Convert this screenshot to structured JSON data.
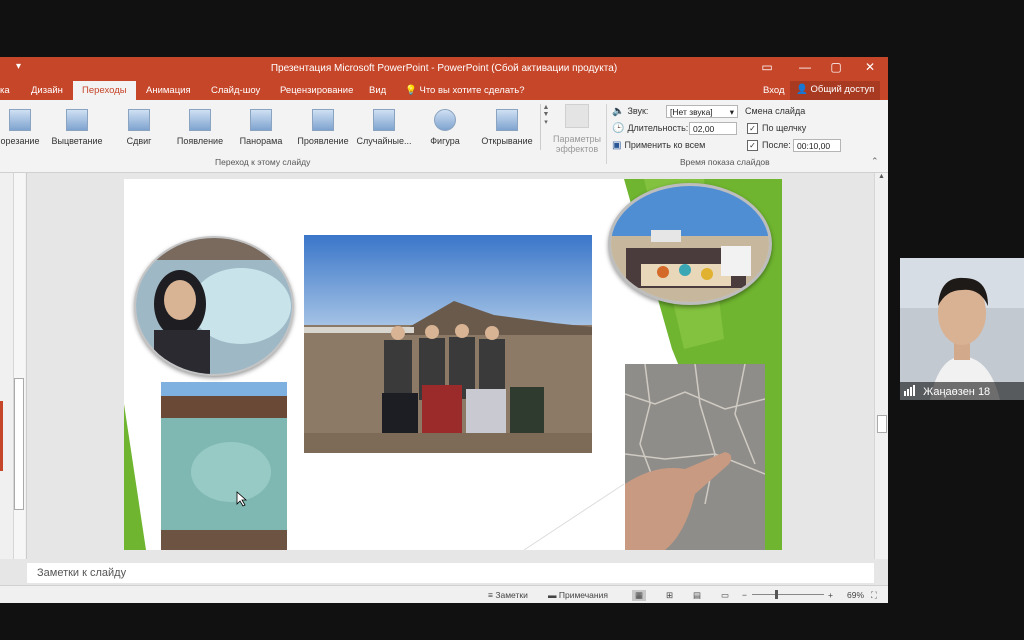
{
  "window": {
    "qa_mark": "▾",
    "title": "Презентация Microsoft PowerPoint - PowerPoint (Сбой активации продукта)",
    "restore_icon": "▭",
    "minimize_icon": "—",
    "maximize_icon": "▢",
    "close_icon": "✕"
  },
  "tabs": {
    "partial_left": "ка",
    "items": [
      "Дизайн",
      "Переходы",
      "Анимация",
      "Слайд-шоу",
      "Рецензирование",
      "Вид"
    ],
    "active": "Переходы",
    "tell_me": "Что вы хотите сделать?",
    "sign_in": "Вход",
    "share": "Общий доступ"
  },
  "ribbon": {
    "transitions": [
      "орезание",
      "Выцветание",
      "Сдвиг",
      "Появление",
      "Панорама",
      "Проявление",
      "Случайные...",
      "Фигура",
      "Открывание"
    ],
    "effects_line1": "Параметры",
    "effects_line2": "эффектов",
    "group_transition": "Переход к этому слайду",
    "sound_label": "Звук:",
    "sound_value": "[Нет звука]",
    "duration_label": "Длительность:",
    "duration_value": "02,00",
    "apply_all": "Применить ко всем",
    "advance_title": "Смена слайда",
    "on_click": "По щелчку",
    "after": "После:",
    "after_value": "00:10,00",
    "group_timing": "Время показа слайдов"
  },
  "notes": {
    "placeholder": "Заметки к слайду"
  },
  "status": {
    "notes": "Заметки",
    "comments": "Примечания",
    "zoom": "69%",
    "zoom_minus": "−",
    "zoom_plus": "+"
  },
  "participant": {
    "name": "Жаңаөзен 18"
  },
  "colors": {
    "accent": "#c6462a",
    "slide_green": "#6fb52f"
  }
}
